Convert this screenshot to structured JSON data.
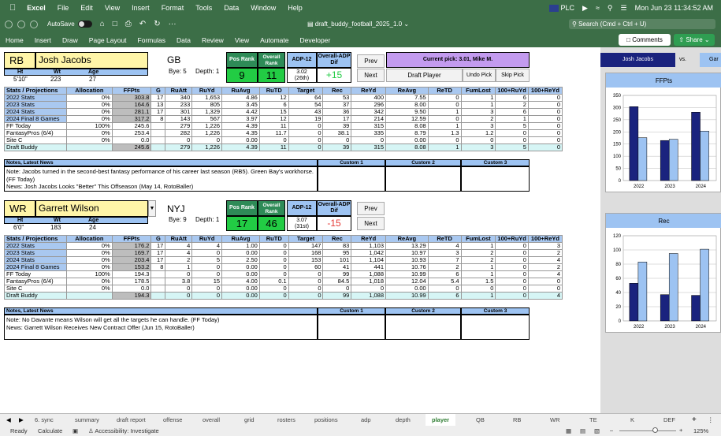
{
  "menubar": {
    "app": "Excel",
    "items": [
      "File",
      "Edit",
      "View",
      "Insert",
      "Format",
      "Tools",
      "Data",
      "Window",
      "Help"
    ],
    "plc": "PLC",
    "clock": "Mon Jun 23  11:34:52 AM"
  },
  "titlebar": {
    "autosave": "AutoSave",
    "doc": "draft_buddy_football_2025_1.0",
    "search": "Search (Cmd + Ctrl + U)"
  },
  "ribbon": {
    "tabs": [
      "Home",
      "Insert",
      "Draw",
      "Page Layout",
      "Formulas",
      "Data",
      "Review",
      "View",
      "Automate",
      "Developer"
    ],
    "comments": "Comments",
    "share": "Share"
  },
  "labels": {
    "ht": "Ht",
    "wt": "Wt",
    "age": "Age",
    "pos_rank": "Pos Rank",
    "overall_rank": "Overall Rank",
    "adp": "ADP-12",
    "overall_adp": "Overall-ADP Dif",
    "prev": "Prev",
    "next": "Next",
    "notes_hdr": "Notes, Latest News",
    "custom1": "Custom 1",
    "custom2": "Custom 2",
    "custom3": "Custom 3",
    "bye_lbl": "Bye:",
    "depth_lbl": "Depth:"
  },
  "draft": {
    "current_pick": "Current pick: 3.01, Mike M.",
    "draft_player": "Draft Player",
    "undo": "Undo Pick",
    "skip": "Skip Pick"
  },
  "columns": [
    "Stats / Projections",
    "Allocation",
    "FFPts",
    "G",
    "RuAtt",
    "RuYd",
    "RuAvg",
    "RuTD",
    "Target",
    "Rec",
    "ReYd",
    "ReAvg",
    "ReTD",
    "FumLost",
    "100+RuYd",
    "100+ReYd"
  ],
  "player1": {
    "pos": "RB",
    "name": "Josh Jacobs",
    "team": "GB",
    "bye": "5",
    "depth": "1",
    "ht": "5'10\"",
    "wt": "223",
    "age": "27",
    "pos_rank": "9",
    "overall_rank": "11",
    "adp": "3.02",
    "adp_rank": "(26th)",
    "adp_dif": "+15",
    "rows": [
      [
        "2022 Stats",
        "0%",
        "303.8",
        "17",
        "340",
        "1,653",
        "4.86",
        "12",
        "64",
        "53",
        "400",
        "7.55",
        "0",
        "1",
        "6",
        "0"
      ],
      [
        "2023 Stats",
        "0%",
        "164.6",
        "13",
        "233",
        "805",
        "3.45",
        "6",
        "54",
        "37",
        "296",
        "8.00",
        "0",
        "1",
        "2",
        "0"
      ],
      [
        "2024 Stats",
        "0%",
        "281.1",
        "17",
        "301",
        "1,329",
        "4.42",
        "15",
        "43",
        "36",
        "342",
        "9.50",
        "1",
        "3",
        "6",
        "0"
      ],
      [
        "2024 Final 8 Games",
        "0%",
        "317.2",
        "8",
        "143",
        "567",
        "3.97",
        "12",
        "19",
        "17",
        "214",
        "12.59",
        "0",
        "2",
        "1",
        "0"
      ],
      [
        "FF Today",
        "100%",
        "245.6",
        "",
        "279",
        "1,226",
        "4.39",
        "11",
        "0",
        "39",
        "315",
        "8.08",
        "1",
        "3",
        "5",
        "0"
      ],
      [
        "FantasyPros (6/4)",
        "0%",
        "253.4",
        "",
        "282",
        "1,226",
        "4.35",
        "11.7",
        "0",
        "38.1",
        "335",
        "8.79",
        "1.3",
        "1.2",
        "0",
        "0"
      ],
      [
        "Site C",
        "0%",
        "0.0",
        "",
        "0",
        "0",
        "0.00",
        "0",
        "0",
        "0",
        "0",
        "0.00",
        "0",
        "0",
        "0",
        "0"
      ],
      [
        "Draft Buddy",
        "",
        "245.6",
        "",
        "279",
        "1,226",
        "4.39",
        "11",
        "0",
        "39",
        "315",
        "8.08",
        "1",
        "3",
        "5",
        "0"
      ]
    ],
    "notes": "Note: Jacobs turned in the second-best fantasy performance of his career last season (RB5). Green Bay's workhorse. (FF Today)",
    "news": "News: Josh Jacobs Looks \"Better\" This Offseason (May 14, RotoBaller)"
  },
  "player2": {
    "pos": "WR",
    "name": "Garrett Wilson",
    "team": "NYJ",
    "bye": "9",
    "depth": "1",
    "ht": "6'0\"",
    "wt": "183",
    "age": "24",
    "pos_rank": "17",
    "overall_rank": "46",
    "adp": "3.07",
    "adp_rank": "(31st)",
    "adp_dif": "-15",
    "rows": [
      [
        "2022 Stats",
        "0%",
        "176.2",
        "17",
        "4",
        "4",
        "1.00",
        "0",
        "147",
        "83",
        "1,103",
        "13.29",
        "4",
        "1",
        "0",
        "3"
      ],
      [
        "2023 Stats",
        "0%",
        "169.7",
        "17",
        "4",
        "0",
        "0.00",
        "0",
        "168",
        "95",
        "1,042",
        "10.97",
        "3",
        "2",
        "0",
        "2"
      ],
      [
        "2024 Stats",
        "0%",
        "203.4",
        "17",
        "2",
        "5",
        "2.50",
        "0",
        "153",
        "101",
        "1,104",
        "10.93",
        "7",
        "2",
        "0",
        "4"
      ],
      [
        "2024 Final 8 Games",
        "0%",
        "153.2",
        "8",
        "1",
        "0",
        "0.00",
        "0",
        "60",
        "41",
        "441",
        "10.76",
        "2",
        "1",
        "0",
        "2"
      ],
      [
        "FF Today",
        "100%",
        "194.3",
        "",
        "0",
        "0",
        "0.00",
        "0",
        "0",
        "99",
        "1,088",
        "10.99",
        "6",
        "1",
        "0",
        "4"
      ],
      [
        "FantasyPros (6/4)",
        "0%",
        "178.5",
        "",
        "3.8",
        "15",
        "4.00",
        "0.1",
        "0",
        "84.5",
        "1,018",
        "12.04",
        "5.4",
        "1.5",
        "0",
        "0"
      ],
      [
        "Site C",
        "0%",
        "0.0",
        "",
        "0",
        "0",
        "0.00",
        "0",
        "0",
        "0",
        "0",
        "0.00",
        "0",
        "0",
        "0",
        "0"
      ],
      [
        "Draft Buddy",
        "",
        "194.3",
        "",
        "0",
        "0",
        "0.00",
        "0",
        "0",
        "99",
        "1,088",
        "10.99",
        "6",
        "1",
        "0",
        "4"
      ]
    ],
    "notes": "Note: No Davante means Wilson will get all the targets he can handle. (FF Today)",
    "news": "News: Garrett Wilson Receives New Contract Offer (Jun 15, RotoBaller)"
  },
  "compare": {
    "left": "Josh Jacobs",
    "vs": "vs.",
    "right": "Gar"
  },
  "chart_data": [
    {
      "type": "bar",
      "title": "FFPts",
      "categories": [
        "2022",
        "2023",
        "2024"
      ],
      "series": [
        {
          "values": [
            303.8,
            164.6,
            281.1
          ]
        },
        {
          "values": [
            176.2,
            169.7,
            203.4
          ]
        }
      ],
      "ylim": [
        0,
        350
      ],
      "yticks": [
        "350",
        "300",
        "250",
        "200",
        "150",
        "100",
        "50",
        "0"
      ]
    },
    {
      "type": "bar",
      "title": "Rec",
      "categories": [
        "2022",
        "2023",
        "2024"
      ],
      "series": [
        {
          "values": [
            53,
            37,
            36
          ]
        },
        {
          "values": [
            83,
            95,
            101
          ]
        }
      ],
      "ylim": [
        0,
        120
      ],
      "yticks": [
        "120",
        "100",
        "80",
        "60",
        "40",
        "20",
        "0"
      ]
    }
  ],
  "colors": {
    "series1": "#1a237e",
    "series2": "#9dc3f2"
  },
  "sheets": [
    "6. sync",
    "summary",
    "draft report",
    "offense",
    "overall",
    "grid",
    "rosters",
    "positions",
    "adp",
    "depth",
    "player",
    "QB",
    "RB",
    "WR",
    "TE",
    "K",
    "DEF"
  ],
  "status": {
    "ready": "Ready",
    "calculate": "Calculate",
    "accessibility": "Accessibility: Investigate",
    "zoom": "125%"
  }
}
